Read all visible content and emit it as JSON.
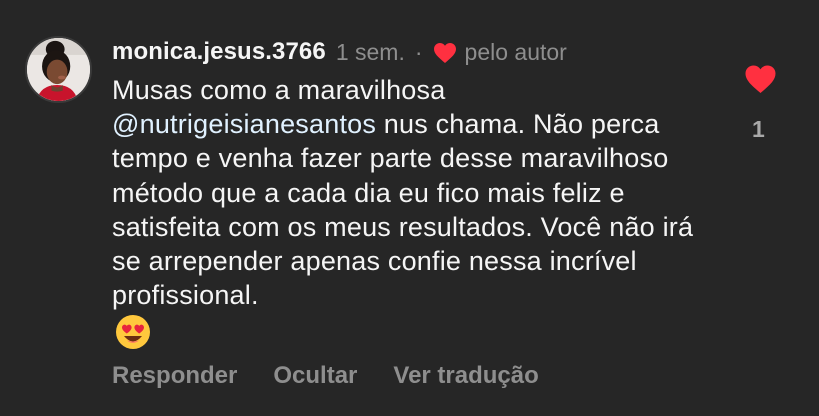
{
  "comment": {
    "username": "monica.jesus.3766",
    "time": "1 sem.",
    "separator": "·",
    "author_liked_label": "pelo autor",
    "mention": "@nutrigeisianesantos",
    "text_before_mention": "Musas como a maravilhosa",
    "text_after_mention": " nus chama. Não perca tempo e venha fazer parte desse maravilhoso método que a cada dia eu fico mais feliz e satisfeita com os meus resultados. Você não irá se arrepender apenas confie nessa incrível profissional.",
    "emoji": "heart-eyes-emoji",
    "like_count": "1"
  },
  "actions": {
    "reply": "Responder",
    "hide": "Ocultar",
    "translate": "Ver tradução"
  },
  "colors": {
    "background": "#262626",
    "heart": "#ff3040",
    "muted": "#8e8e8e",
    "mention": "#e0f1ff"
  }
}
